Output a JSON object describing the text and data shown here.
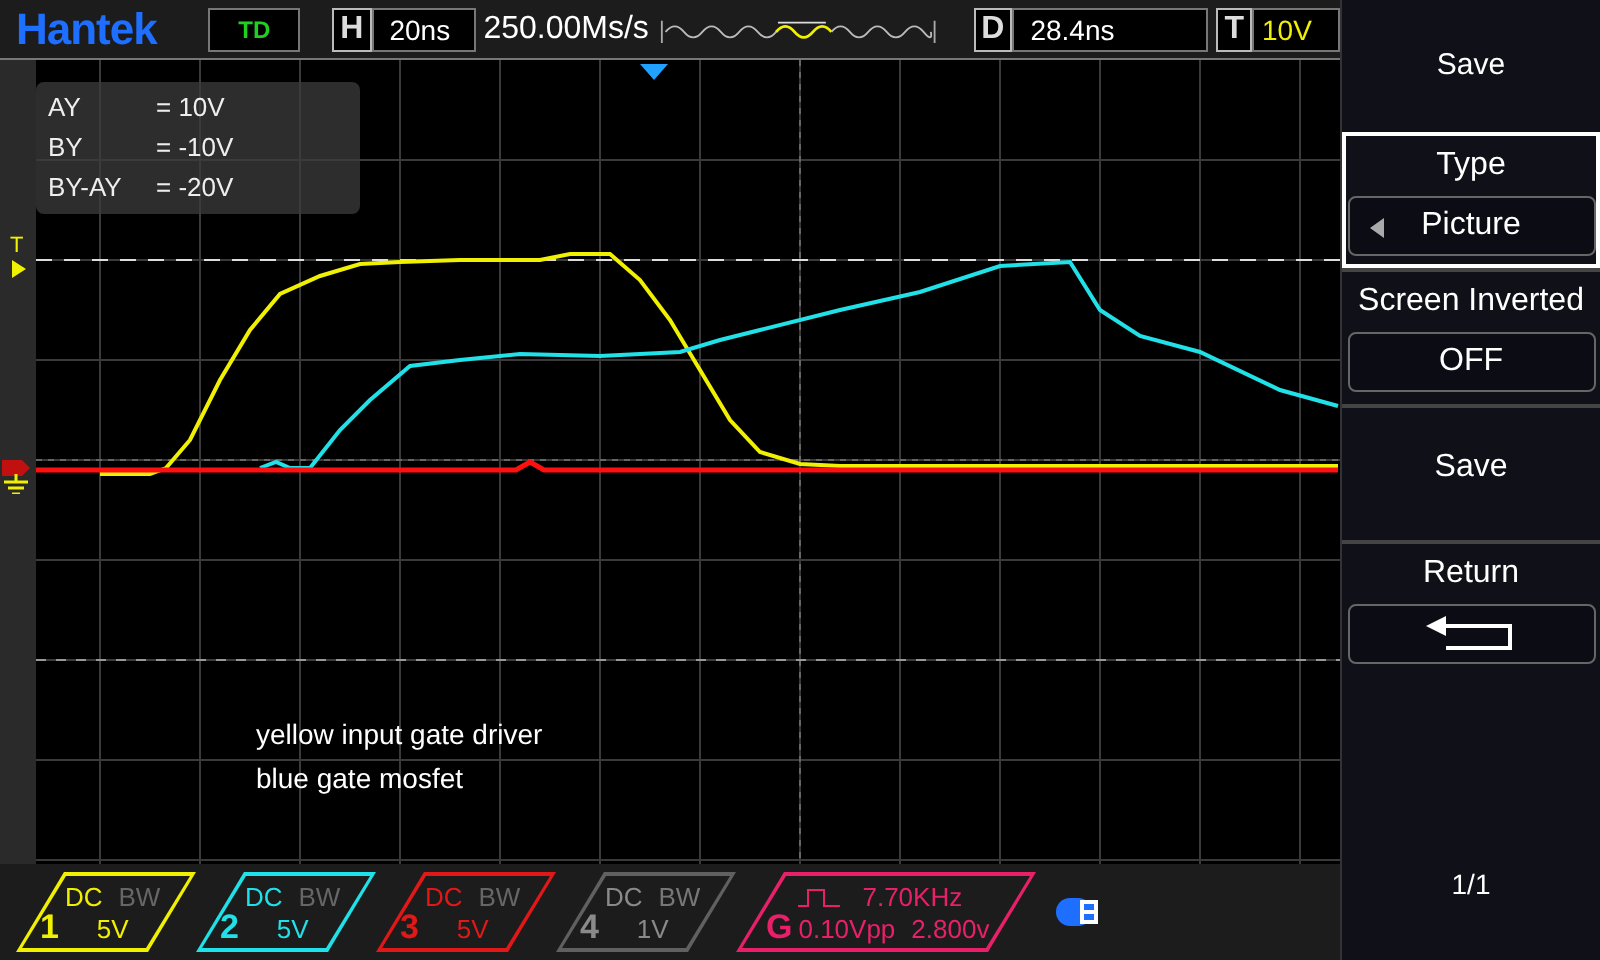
{
  "top_bar": {
    "logo": "Hantek",
    "mode": "TD",
    "horizontal": {
      "label": "H",
      "value": "20ns"
    },
    "sample_rate": "250.00Ms/s",
    "delay": {
      "label": "D",
      "value": "28.4ns"
    },
    "trigger": {
      "label": "T",
      "value": "10V"
    }
  },
  "cursor_readout": [
    {
      "label": "AY",
      "value": "= 10V"
    },
    {
      "label": "BY",
      "value": "= -10V"
    },
    {
      "label": "BY-AY",
      "value": "= -20V"
    }
  ],
  "notes": [
    "yellow input gate driver",
    "blue gate mosfet"
  ],
  "markers": {
    "trigger": "T"
  },
  "channels": [
    {
      "number": "1",
      "coupling": "DC",
      "bandwidth": "BW",
      "scale": "5V",
      "color": "#f0f000",
      "active": true
    },
    {
      "number": "2",
      "coupling": "DC",
      "bandwidth": "BW",
      "scale": "5V",
      "color": "#20e0e8",
      "active": true
    },
    {
      "number": "3",
      "coupling": "DC",
      "bandwidth": "BW",
      "scale": "5V",
      "color": "#e01818",
      "active": true
    },
    {
      "number": "4",
      "coupling": "DC",
      "bandwidth": "BW",
      "scale": "1V",
      "color": "#606060",
      "active": false
    }
  ],
  "generator": {
    "label": "G",
    "frequency": "7.70KHz",
    "amplitude": "0.10Vpp",
    "offset": "2.800v",
    "color": "#e8206a"
  },
  "menu": {
    "title": "Save",
    "items": [
      {
        "kind": "option",
        "label": "Type",
        "value": "Picture",
        "selected": true
      },
      {
        "kind": "option",
        "label": "Screen Inverted",
        "value": "OFF",
        "selected": false
      },
      {
        "kind": "action",
        "label": "Save",
        "selected": false
      },
      {
        "kind": "back",
        "label": "Return",
        "selected": false
      }
    ]
  },
  "page": "1/1"
}
